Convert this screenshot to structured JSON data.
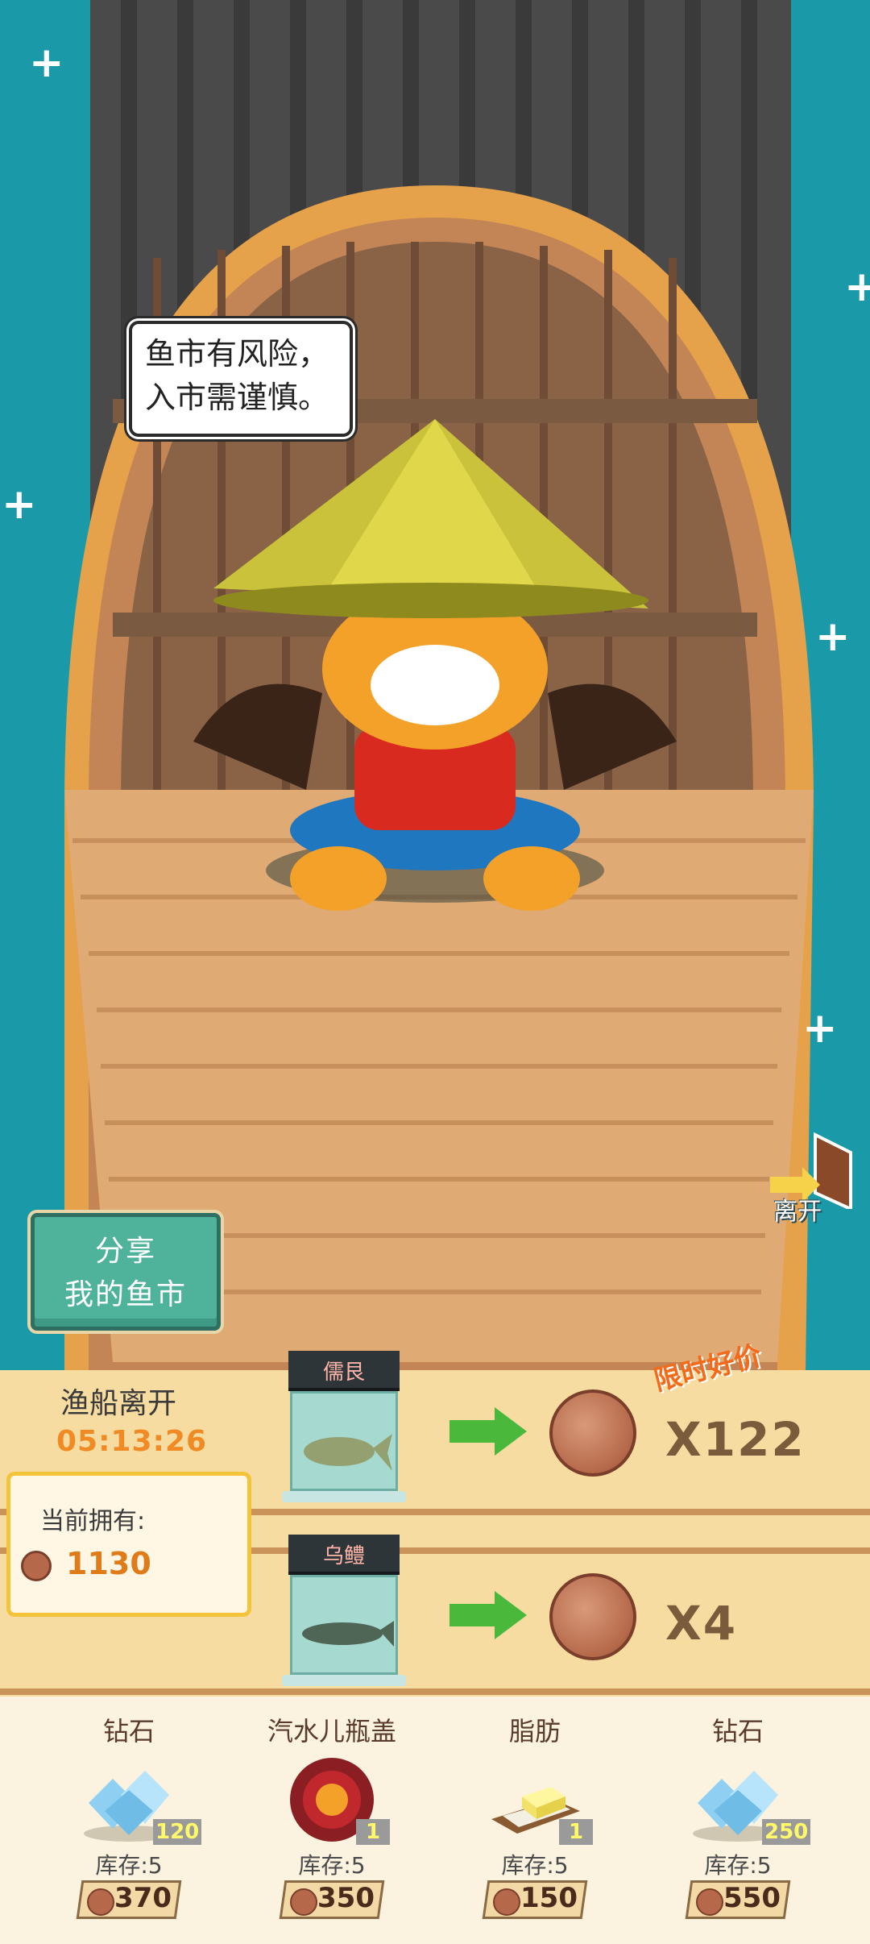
{
  "speech": {
    "line1": "鱼市有风险，",
    "line2": "入市需谨慎。"
  },
  "share_button": {
    "line1": "分享",
    "line2": "我的鱼市"
  },
  "leave_button": {
    "label": "离开"
  },
  "departure": {
    "label": "渔船离开",
    "timer": "05:13:26"
  },
  "owned": {
    "label": "当前拥有:",
    "value": "1130"
  },
  "trades": [
    {
      "fish": "儒艮",
      "quantity": "X122",
      "deal_label": "限时好价"
    },
    {
      "fish": "乌鳢",
      "quantity": "X4"
    }
  ],
  "goods": [
    {
      "name": "钻石",
      "count": "120",
      "stock": "库存:5",
      "price": "370"
    },
    {
      "name": "汽水儿瓶盖",
      "count": "1",
      "stock": "库存:5",
      "price": "350"
    },
    {
      "name": "脂肪",
      "count": "1",
      "stock": "库存:5",
      "price": "150"
    },
    {
      "name": "钻石",
      "count": "250",
      "stock": "库存:5",
      "price": "550"
    }
  ],
  "colors": {
    "sea": "#1a9aa8",
    "timer": "#f08a24",
    "deal": "#f26a1a",
    "share": "#4fb39c"
  }
}
